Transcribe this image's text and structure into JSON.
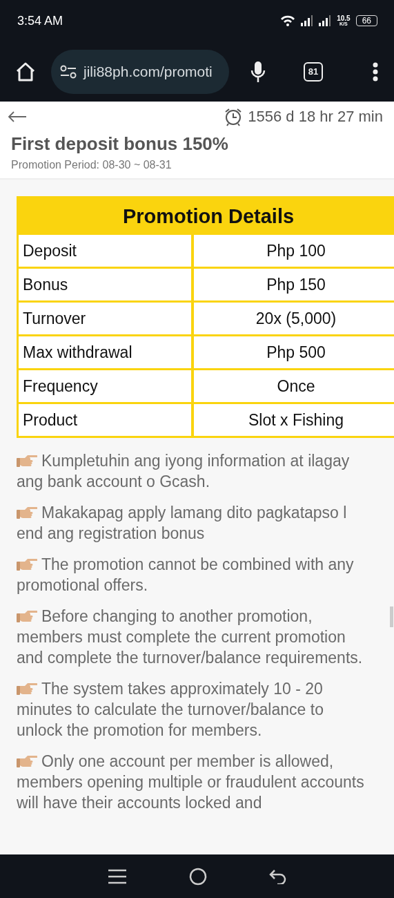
{
  "status_bar": {
    "time": "3:54 AM",
    "network_speed": "10.5",
    "network_unit": "K/S",
    "battery": "66"
  },
  "browser": {
    "url": "jili88ph.com/promoti",
    "tab_count": "81"
  },
  "header": {
    "countdown": "1556 d 18 hr 27 min",
    "title": "First deposit bonus 150%",
    "period": "Promotion Period: 08-30 ~ 08-31"
  },
  "details_table": {
    "title": "Promotion Details",
    "rows": [
      {
        "label": "Deposit",
        "value": "Php 100"
      },
      {
        "label": "Bonus",
        "value": "Php 150"
      },
      {
        "label": "Turnover",
        "value": "20x (5,000)"
      },
      {
        "label": "Max withdrawal",
        "value": "Php 500"
      },
      {
        "label": "Frequency",
        "value": "Once"
      },
      {
        "label": "Product",
        "value": "Slot x Fishing"
      }
    ]
  },
  "rules": [
    "Kumpletuhin ang iyong information at ilagay ang bank account o Gcash.",
    "Makakapag apply lamang dito pagkatapso l end ang registration bonus",
    "The promotion cannot be combined with any promotional offers.",
    "Before changing to another promotion, members must complete the current promotion and complete the turnover/balance requirements.",
    "The system takes approximately 10 - 20 minutes to calculate the turnover/balance to unlock the promotion for members.",
    "Only one account per member is allowed, members opening multiple or fraudulent accounts will have their accounts locked and"
  ]
}
